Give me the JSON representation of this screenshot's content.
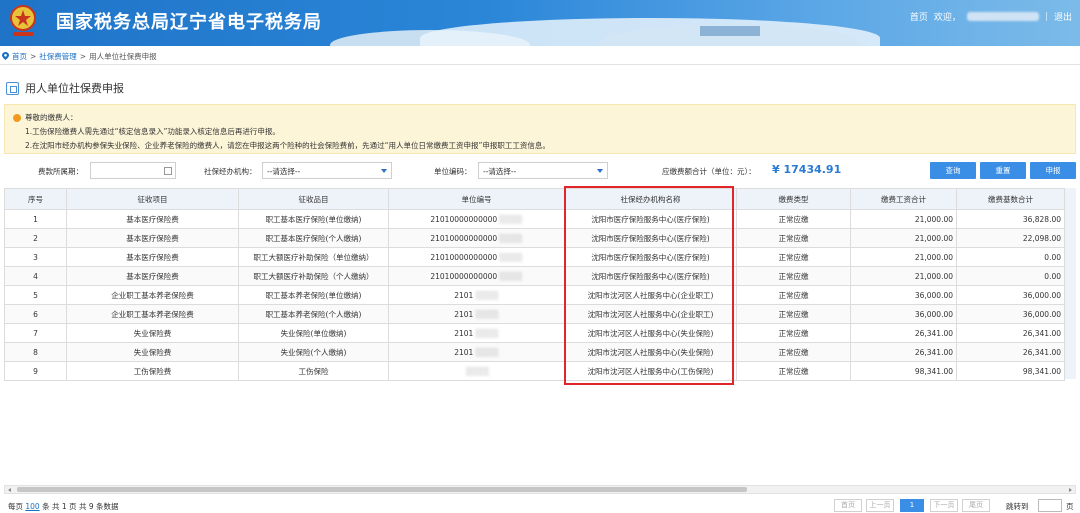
{
  "header": {
    "title": "国家税务总局辽宁省电子税务局",
    "links": {
      "home": "首页",
      "welcome": "欢迎，",
      "sep": "|",
      "logout": "退出"
    },
    "colors": {
      "banner": "#1f74c8"
    }
  },
  "breadcrumb": {
    "home": "首页",
    "sep1": ">",
    "section": "社保费管理",
    "sep2": ">",
    "current": "用人单位社保费申报"
  },
  "page_title": "用人单位社保费申报",
  "notice": {
    "title": "尊敬的缴费人：",
    "line1": "1.工伤保险缴费人需先通过“核定信息录入”功能录入核定信息后再进行申报。",
    "line2": "2.在沈阳市经办机构参保失业保险、企业养老保险的缴费人，请您在申报这两个险种的社会保险费前，先通过“用人单位日常缴费工资申报”申报职工工资信息。"
  },
  "filters": {
    "period_label": "费款所属期：",
    "agency_label": "社保经办机构：",
    "agency_value": "--请选择--",
    "unit_code_label": "单位编码：",
    "unit_code_value": "--请选择--",
    "total_label": "应缴费额合计（单位：元）：",
    "total_value": "¥ 17434.91"
  },
  "buttons": {
    "query": "查询",
    "reset": "重置",
    "declare": "申报"
  },
  "table": {
    "headers": [
      "序号",
      "征收项目",
      "征收品目",
      "单位编号",
      "社保经办机构名称",
      "缴费类型",
      "缴费工资合计",
      "缴费基数合计"
    ],
    "rows": [
      [
        "1",
        "基本医疗保险费",
        "职工基本医疗保险(单位缴纳)",
        "21010000000000",
        "沈阳市医疗保险服务中心(医疗保险)",
        "正常应缴",
        "21,000.00",
        "36,828.00"
      ],
      [
        "2",
        "基本医疗保险费",
        "职工基本医疗保险(个人缴纳)",
        "21010000000000",
        "沈阳市医疗保险服务中心(医疗保险)",
        "正常应缴",
        "21,000.00",
        "22,098.00"
      ],
      [
        "3",
        "基本医疗保险费",
        "职工大额医疗补助保险（单位缴纳）",
        "21010000000000",
        "沈阳市医疗保险服务中心(医疗保险)",
        "正常应缴",
        "21,000.00",
        "0.00"
      ],
      [
        "4",
        "基本医疗保险费",
        "职工大额医疗补助保险（个人缴纳）",
        "21010000000000",
        "沈阳市医疗保险服务中心(医疗保险)",
        "正常应缴",
        "21,000.00",
        "0.00"
      ],
      [
        "5",
        "企业职工基本养老保险费",
        "职工基本养老保险(单位缴纳)",
        "2101",
        "沈阳市沈河区人社服务中心(企业职工)",
        "正常应缴",
        "36,000.00",
        "36,000.00"
      ],
      [
        "6",
        "企业职工基本养老保险费",
        "职工基本养老保险(个人缴纳)",
        "2101",
        "沈阳市沈河区人社服务中心(企业职工)",
        "正常应缴",
        "36,000.00",
        "36,000.00"
      ],
      [
        "7",
        "失业保险费",
        "失业保险(单位缴纳)",
        "2101",
        "沈阳市沈河区人社服务中心(失业保险)",
        "正常应缴",
        "26,341.00",
        "26,341.00"
      ],
      [
        "8",
        "失业保险费",
        "失业保险(个人缴纳)",
        "2101",
        "沈阳市沈河区人社服务中心(失业保险)",
        "正常应缴",
        "26,341.00",
        "26,341.00"
      ],
      [
        "9",
        "工伤保险费",
        "工伤保险",
        "",
        "沈阳市沈河区人社服务中心(工伤保险)",
        "正常应缴",
        "98,341.00",
        "98,341.00"
      ]
    ]
  },
  "pager": {
    "per_page_prefix": "每页",
    "per_page": "100",
    "per_page_suffix": "条 共 1 页",
    "total": "共 9 条数据",
    "first": "首页",
    "prev": "上一页",
    "current": "1",
    "next": "下一页",
    "last": "尾页",
    "jump_label": "跳转到",
    "jump_suffix": "页"
  },
  "icons": [
    "emblem-icon",
    "location-pin-icon",
    "notice-dot-icon",
    "calendar-icon",
    "chevron-down-icon",
    "page-title-icon"
  ]
}
